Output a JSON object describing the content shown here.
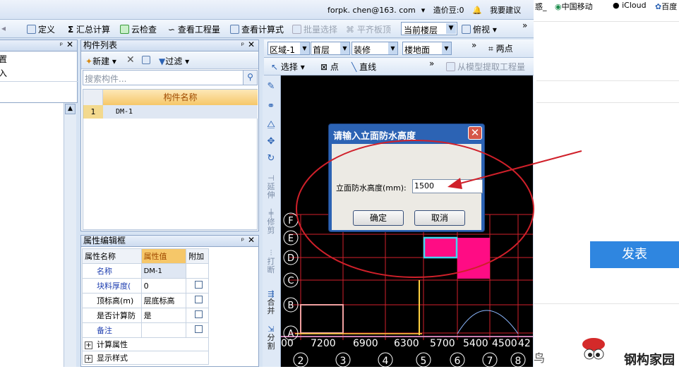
{
  "topbar": {
    "account": "forpk. chen@163. com",
    "beans": "造价豆:0",
    "suggest": "我要建议"
  },
  "toolbar": {
    "define": "定义",
    "calc": "汇总计算",
    "cloud": "云检查",
    "view_qty": "查看工程量",
    "view_formula": "查看计算式",
    "batch": "批量选择",
    "flush": "平齐板顶",
    "floor": "当前楼层",
    "view": "俯视",
    "more": "»"
  },
  "toolbar2": {
    "region": "区域-1",
    "level": "首层",
    "category": "装修",
    "type": "楼地面",
    "more": "»",
    "twopoint": "两点",
    "select": "选择",
    "point": "点",
    "line": "直线",
    "extract": "从模型提取工程量"
  },
  "left_panel": {
    "item1": "置",
    "item2": "入"
  },
  "component_list": {
    "title": "构件列表",
    "new": "新建",
    "filter": "过滤",
    "search_placeholder": "搜索构件...",
    "column": "构件名称",
    "rows": [
      {
        "index": "1",
        "name": "DM-1"
      }
    ]
  },
  "props": {
    "title": "属性编辑框",
    "col_name": "属性名称",
    "col_value": "属性值",
    "col_extra": "附加",
    "rows": [
      {
        "name": "名称",
        "value": "DM-1"
      },
      {
        "name": "块料厚度(",
        "value": "0"
      },
      {
        "name": "顶标高(m)",
        "value": "层底标高"
      },
      {
        "name": "是否计算防",
        "value": "是"
      },
      {
        "name": "备注",
        "value": ""
      }
    ],
    "group1": "计算属性",
    "group2": "显示样式"
  },
  "vtools": {
    "extend": "延伸",
    "trim": "修剪",
    "break": "打断",
    "merge": "合并",
    "split": "分割"
  },
  "dialog": {
    "title": "请输入立面防水高度",
    "label": "立面防水高度(mm):",
    "value": "1500",
    "ok": "确定",
    "cancel": "取消"
  },
  "grid": {
    "rows": [
      "F",
      "E",
      "D",
      "C",
      "B",
      "A"
    ],
    "dims": [
      "00",
      "7200",
      "6900",
      "6300",
      "5700",
      "5400",
      "4500",
      "42"
    ],
    "cols": [
      "2",
      "3",
      "4",
      "5",
      "6",
      "7",
      "8"
    ]
  },
  "browser": {
    "b1": "惑_",
    "b2": "中国移动",
    "b3": "iCloud",
    "b4": "百度",
    "post": "发表",
    "brand": "钢构家园",
    "frag": "鸟"
  },
  "colors": {
    "accent": "#2c63b4",
    "magenta": "#ff0c84",
    "post": "#2f86e0",
    "annot": "#d0202a"
  }
}
